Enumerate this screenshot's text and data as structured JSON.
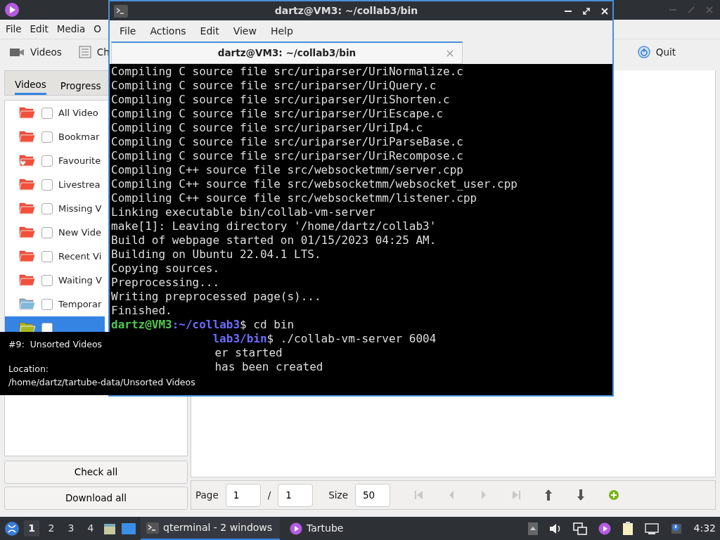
{
  "app_window": {
    "menu": [
      "File",
      "Edit",
      "Media",
      "O"
    ],
    "toolbar": [
      {
        "label": "Videos",
        "kind": "videos"
      },
      {
        "label": "Ch",
        "kind": "channels"
      },
      {
        "label": "Quit",
        "kind": "quit"
      }
    ],
    "tabs": [
      {
        "label": "Videos",
        "selected": true
      },
      {
        "label": "Progress",
        "selected": false
      }
    ],
    "folders": [
      {
        "label": "All Video",
        "color": "#f0503c",
        "kind": "folder",
        "checked": false,
        "selected": false
      },
      {
        "label": "Bookmar",
        "color": "#f0503c",
        "kind": "folder",
        "checked": false,
        "selected": false
      },
      {
        "label": "Favourite",
        "color": "#f0503c",
        "kind": "favourite",
        "checked": false,
        "selected": false
      },
      {
        "label": "Livestrea",
        "color": "#f0503c",
        "kind": "folder",
        "checked": false,
        "selected": false
      },
      {
        "label": "Missing V",
        "color": "#f0503c",
        "kind": "folder",
        "checked": false,
        "selected": false
      },
      {
        "label": "New Vide",
        "color": "#f0503c",
        "kind": "folder",
        "checked": false,
        "selected": false
      },
      {
        "label": "Recent Vi",
        "color": "#f0503c",
        "kind": "folder",
        "checked": false,
        "selected": false
      },
      {
        "label": "Waiting V",
        "color": "#f0503c",
        "kind": "folder",
        "checked": false,
        "selected": false
      },
      {
        "label": "Temporar",
        "color": "#7fb8d8",
        "kind": "folder",
        "checked": false,
        "selected": false
      },
      {
        "color": "#a8b820",
        "kind": "folder",
        "checked": false,
        "selected": true
      }
    ],
    "buttons": [
      "Check all",
      "Download all"
    ],
    "pager": {
      "page_label": "Page",
      "page": "1",
      "separator": "/",
      "pages": "1",
      "size_label": "Size",
      "size": "50"
    },
    "pager_tools": [
      {
        "kind": "first",
        "disabled": true
      },
      {
        "kind": "prev",
        "disabled": true
      },
      {
        "kind": "next",
        "disabled": true
      },
      {
        "kind": "last",
        "disabled": true
      },
      {
        "kind": "up",
        "disabled": false
      },
      {
        "kind": "down",
        "disabled": false
      },
      {
        "kind": "add",
        "disabled": false
      }
    ]
  },
  "tooltip": {
    "title_number": "#9:",
    "title": "Unsorted Videos",
    "location_label": "Location:",
    "location": "/home/dartz/tartube-data/Unsorted Videos"
  },
  "terminal": {
    "title": "dartz@VM3: ~/collab3/bin",
    "menu": [
      "File",
      "Actions",
      "Edit",
      "View",
      "Help"
    ],
    "tab": "dartz@VM3: ~/collab3/bin",
    "lines": [
      {
        "kind": "output",
        "text": "Compiling C source file src/uriparser/UriNormalize.c"
      },
      {
        "kind": "output",
        "text": "Compiling C source file src/uriparser/UriQuery.c"
      },
      {
        "kind": "output",
        "text": "Compiling C source file src/uriparser/UriShorten.c"
      },
      {
        "kind": "output",
        "text": "Compiling C source file src/uriparser/UriEscape.c"
      },
      {
        "kind": "output",
        "text": "Compiling C source file src/uriparser/UriIp4.c"
      },
      {
        "kind": "output",
        "text": "Compiling C source file src/uriparser/UriParseBase.c"
      },
      {
        "kind": "output",
        "text": "Compiling C source file src/uriparser/UriRecompose.c"
      },
      {
        "kind": "output",
        "text": "Compiling C++ source file src/websocketmm/server.cpp"
      },
      {
        "kind": "output",
        "text": "Compiling C++ source file src/websocketmm/websocket_user.cpp"
      },
      {
        "kind": "output",
        "text": "Compiling C++ source file src/websocketmm/listener.cpp"
      },
      {
        "kind": "output",
        "text": "Linking executable bin/collab-vm-server"
      },
      {
        "kind": "output",
        "text": "make[1]: Leaving directory '/home/dartz/collab3'"
      },
      {
        "kind": "output",
        "text": "Build of webpage started on 01/15/2023 04:25 AM."
      },
      {
        "kind": "output",
        "text": "Building on Ubuntu 22.04.1 LTS."
      },
      {
        "kind": "output",
        "text": "Copying sources."
      },
      {
        "kind": "output",
        "text": "Preprocessing..."
      },
      {
        "kind": "output",
        "text": "Writing preprocessed page(s)..."
      },
      {
        "kind": "output",
        "text": "Finished."
      },
      {
        "kind": "prompt",
        "user": "dartz@VM3",
        "path": ":~/collab3",
        "text": "$ cd bin"
      },
      {
        "kind": "clipped-prompt",
        "path": "lab3/bin",
        "text": "$ ./collab-vm-server 6004"
      },
      {
        "kind": "clipped-output",
        "text": "er started"
      },
      {
        "kind": "clipped-output",
        "text": "has been created"
      }
    ]
  },
  "taskbar": {
    "desktops": [
      {
        "label": "1",
        "selected": true
      },
      {
        "label": "2",
        "selected": false
      },
      {
        "label": "3",
        "selected": false
      },
      {
        "label": "4",
        "selected": false
      }
    ],
    "tasks": [
      {
        "label": "qterminal - 2 windows",
        "kind": "terminal",
        "selected": true
      },
      {
        "label": "Tartube",
        "kind": "tartube",
        "selected": false
      }
    ],
    "clock": "4:32"
  }
}
